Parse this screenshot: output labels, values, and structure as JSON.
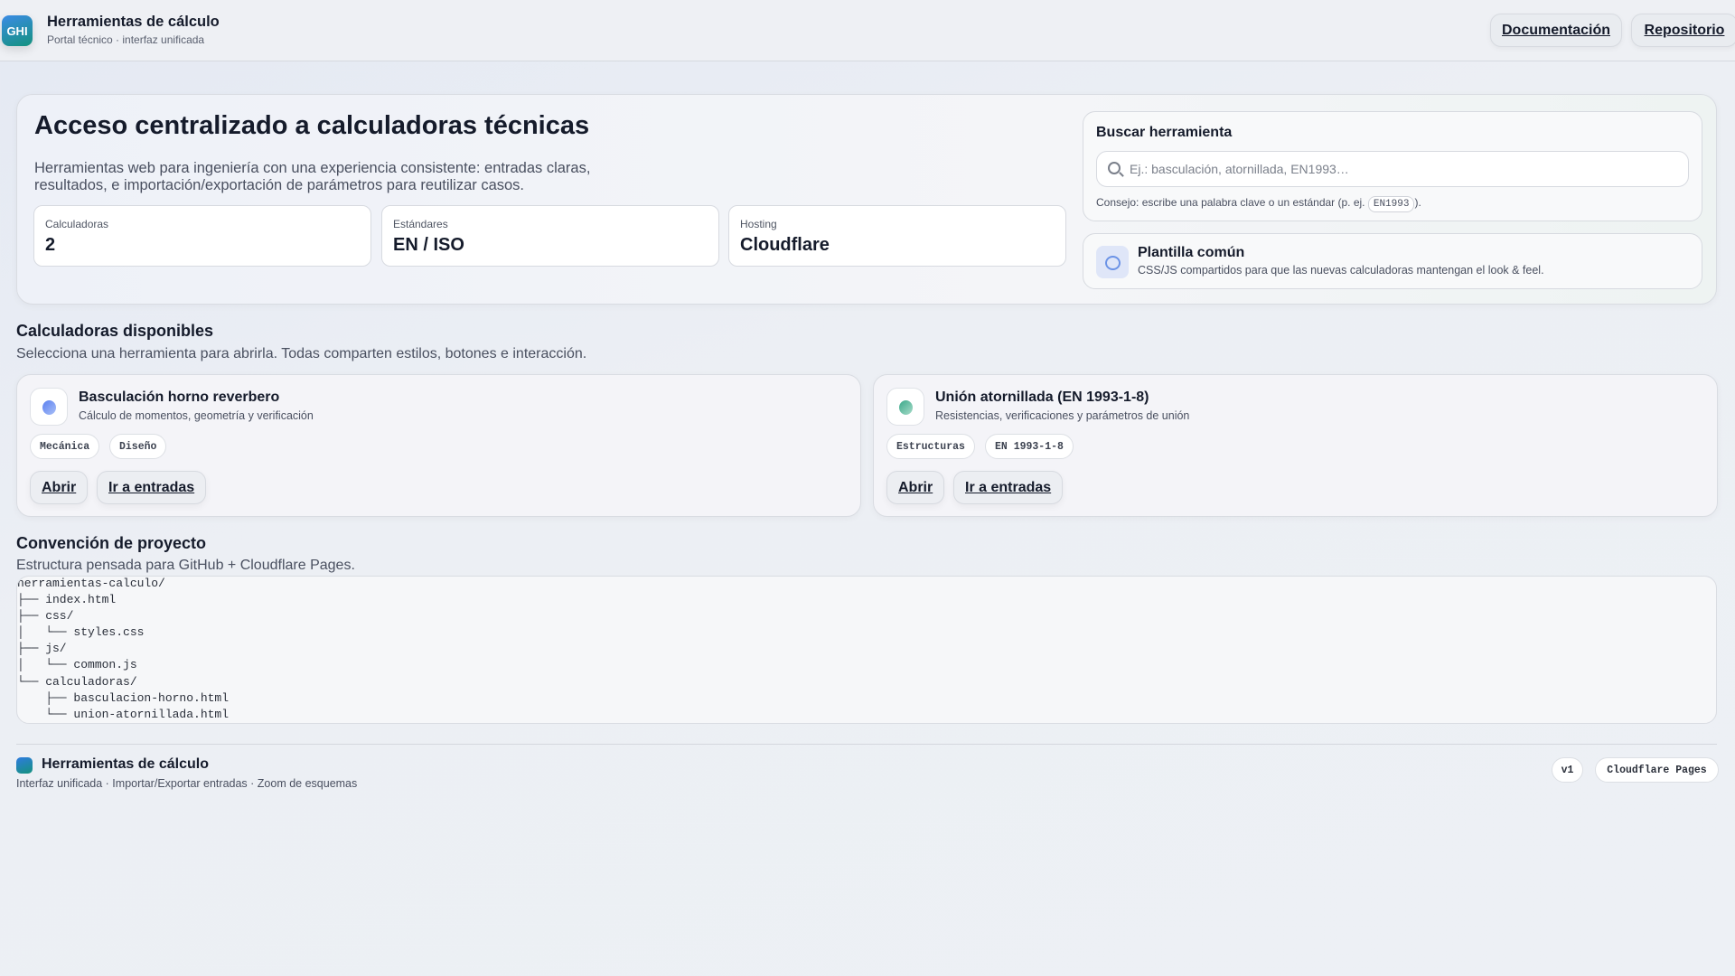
{
  "header": {
    "logo_text": "GHI",
    "title": "Herramientas de cálculo",
    "subtitle": "Portal técnico · interfaz unificada",
    "nav": [
      {
        "label": "Documentación"
      },
      {
        "label": "Repositorio"
      }
    ]
  },
  "hero": {
    "title": "Acceso centralizado a calculadoras técnicas",
    "description": "Herramientas web para ingeniería con una experiencia consistente: entradas claras, resultados, e importación/exportación de parámetros para reutilizar casos.",
    "stats": [
      {
        "label": "Calculadoras",
        "value": "2"
      },
      {
        "label": "Estándares",
        "value": "EN / ISO"
      },
      {
        "label": "Hosting",
        "value": "Cloudflare"
      }
    ]
  },
  "search": {
    "title": "Buscar herramienta",
    "placeholder": "Ej.: basculación, atornillada, EN1993…",
    "tip_prefix": "Consejo: escribe una palabra clave o un estándar (p. ej.",
    "tip_code": "EN1993",
    "tip_suffix": ")."
  },
  "template": {
    "title": "Plantilla común",
    "description": "CSS/JS compartidos para que las nuevas calculadoras mantengan el look & feel."
  },
  "calculators_section": {
    "title": "Calculadoras disponibles",
    "subtitle": "Selecciona una herramienta para abrirla. Todas comparten estilos, botones e interacción."
  },
  "calculators": [
    {
      "title": "Basculación horno reverbero",
      "description": "Cálculo de momentos, geometría y verificación",
      "tags": [
        "Mecánica",
        "Diseño"
      ],
      "open_label": "Abrir",
      "inputs_label": "Ir a entradas",
      "color": "#6b8ff0"
    },
    {
      "title": "Unión atornillada (EN 1993-1-8)",
      "description": "Resistencias, verificaciones y parámetros de unión",
      "tags": [
        "Estructuras",
        "EN 1993-1-8"
      ],
      "open_label": "Abrir",
      "inputs_label": "Ir a entradas",
      "color": "#4fb79a"
    }
  ],
  "convention": {
    "title": "Convención de proyecto",
    "subtitle": "Estructura pensada para GitHub + Cloudflare Pages.",
    "tree": "herramientas-calculo/\n├── index.html\n├── css/\n│   └── styles.css\n├── js/\n│   └── common.js\n└── calculadoras/\n    ├── basculacion-horno.html\n    └── union-atornillada.html"
  },
  "footer": {
    "title": "Herramientas de cálculo",
    "subtitle": "Interfaz unificada · Importar/Exportar entradas · Zoom de esquemas",
    "badges": [
      "v1",
      "Cloudflare Pages"
    ]
  }
}
